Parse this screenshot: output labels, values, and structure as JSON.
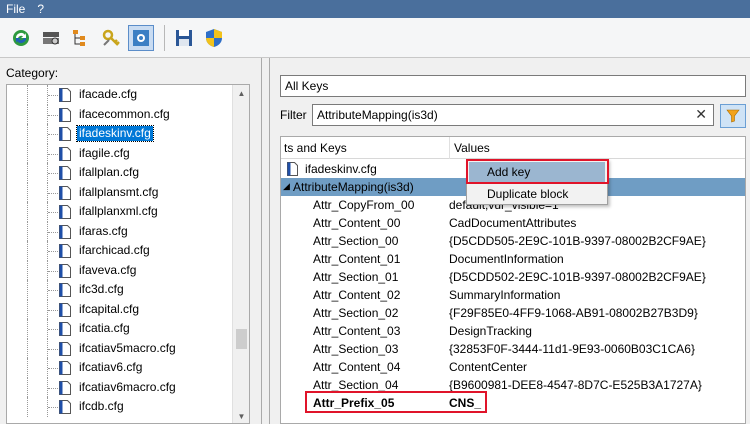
{
  "menu": {
    "file": "File",
    "help": "?"
  },
  "toolbar": {
    "icons": [
      "refresh-icon",
      "settings-gear-icon",
      "tree-structure-icon",
      "key-tool-icon",
      "config-active-icon",
      "save-icon",
      "shield-icon"
    ]
  },
  "left": {
    "category_label": "Category:",
    "items": [
      "ifacade.cfg",
      "ifacecommon.cfg",
      "ifadeskinv.cfg",
      "ifagile.cfg",
      "ifallplan.cfg",
      "ifallplansmt.cfg",
      "ifallplanxml.cfg",
      "ifaras.cfg",
      "ifarchicad.cfg",
      "ifaveva.cfg",
      "ifc3d.cfg",
      "ifcapital.cfg",
      "ifcatia.cfg",
      "ifcatiav5macro.cfg",
      "ifcatiav6.cfg",
      "ifcatiav6macro.cfg",
      "ifcdb.cfg"
    ],
    "selected_index": 2
  },
  "right": {
    "keys_dropdown": "All Keys",
    "filter_label": "Filter",
    "filter_value": "AttributeMapping(is3d)",
    "grid": {
      "col_keys": "ts and Keys",
      "col_values": "Values",
      "file_node": "ifadeskinv.cfg",
      "block_node": "AttributeMapping(is3d)",
      "rows": [
        {
          "key": "Attr_CopyFrom_00",
          "value": "default,vur_visible=1"
        },
        {
          "key": "Attr_Content_00",
          "value": "CadDocumentAttributes"
        },
        {
          "key": "Attr_Section_00",
          "value": "{D5CDD505-2E9C-101B-9397-08002B2CF9AE}"
        },
        {
          "key": "Attr_Content_01",
          "value": "DocumentInformation"
        },
        {
          "key": "Attr_Section_01",
          "value": "{D5CDD502-2E9C-101B-9397-08002B2CF9AE}"
        },
        {
          "key": "Attr_Content_02",
          "value": "SummaryInformation"
        },
        {
          "key": "Attr_Section_02",
          "value": "{F29F85E0-4FF9-1068-AB91-08002B27B3D9}"
        },
        {
          "key": "Attr_Content_03",
          "value": "DesignTracking"
        },
        {
          "key": "Attr_Section_03",
          "value": "{32853F0F-3444-11d1-9E93-0060B03C1CA6}"
        },
        {
          "key": "Attr_Content_04",
          "value": "ContentCenter"
        },
        {
          "key": "Attr_Section_04",
          "value": "{B9600981-DEE8-4547-8D7C-E525B3A1727A}"
        }
      ],
      "new_row": {
        "key": "Attr_Prefix_05",
        "value": "CNS_"
      }
    },
    "context_menu": {
      "add_key": "Add key",
      "duplicate_block": "Duplicate block"
    }
  },
  "colors": {
    "menubar": "#4a6f9c",
    "selection": "#0078d7",
    "row_highlight": "#6f9dc4",
    "annotation": "#e0142a"
  }
}
